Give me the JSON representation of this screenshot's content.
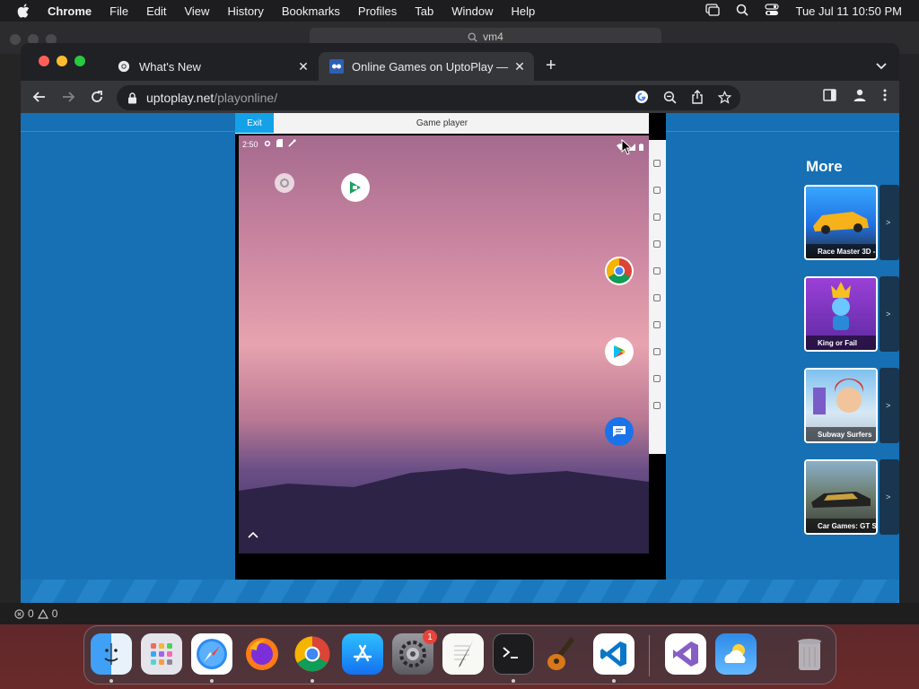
{
  "menubar": {
    "app_name": "Chrome",
    "items": [
      "File",
      "Edit",
      "View",
      "History",
      "Bookmarks",
      "Profiles",
      "Tab",
      "Window",
      "Help"
    ],
    "clock": "Tue Jul 11  10:50 PM"
  },
  "vm": {
    "search_text": "vm4",
    "status_errors": "0",
    "status_warnings": "0"
  },
  "chrome": {
    "tabs": [
      {
        "title": "What's New",
        "icon": "chrome-icon"
      },
      {
        "title": "Online Games on UptoPlay — P",
        "icon": "uptoplay-icon"
      }
    ],
    "url_host": "uptoplay.net",
    "url_path": "/playonline/"
  },
  "player": {
    "exit_label": "Exit",
    "header_title": "Game player",
    "android_time": "2:50"
  },
  "more": {
    "title": "More",
    "cards": [
      {
        "caption": "Race Master 3D -",
        "color": "#f0a020",
        "arrow": ">"
      },
      {
        "caption": "King or Fail",
        "color": "#7a3fc0",
        "arrow": ">"
      },
      {
        "caption": "Subway Surfers",
        "color": "#5aa0d8",
        "arrow": ">"
      },
      {
        "caption": "Car Games: GT Sp",
        "color": "#4a5a6a",
        "arrow": ">"
      }
    ]
  },
  "dock": {
    "items": [
      "finder-icon",
      "launchpad-icon",
      "safari-icon",
      "firefox-icon",
      "chrome-icon",
      "app-store-icon",
      "system-settings-icon",
      "textedit-icon",
      "terminal-icon",
      "garageband-icon",
      "vscode-icon",
      "visual-studio-icon",
      "weather-icon",
      "trash-icon"
    ],
    "settings_badge": "1"
  },
  "colors": {
    "page_bg": "#1670b3",
    "exit_btn": "#13a1e8"
  }
}
